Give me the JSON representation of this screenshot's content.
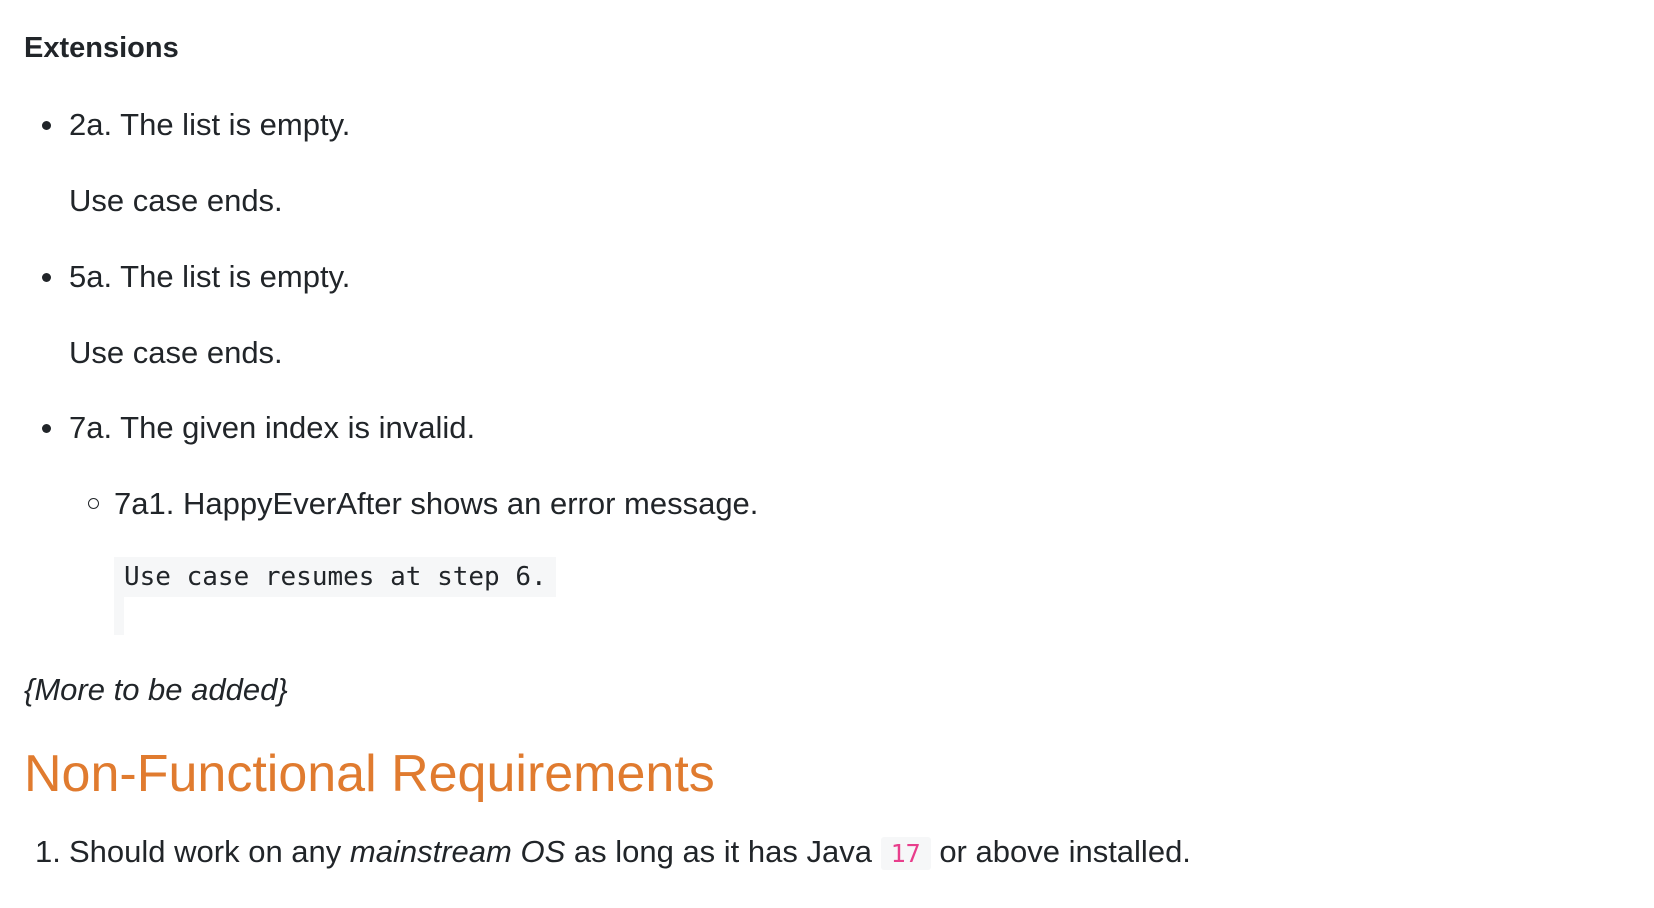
{
  "extensions": {
    "heading": "Extensions",
    "items": [
      {
        "label": "2a. The list is empty.",
        "note": "Use case ends."
      },
      {
        "label": "5a. The list is empty.",
        "note": "Use case ends."
      },
      {
        "label": "7a. The given index is invalid.",
        "sub_items": [
          {
            "label": "7a1. HappyEverAfter shows an error message.",
            "code": "Use case resumes at step 6."
          }
        ]
      }
    ]
  },
  "more_note": "{More to be added}",
  "nfr": {
    "heading": "Non-Functional Requirements",
    "items": [
      {
        "number": "1.",
        "text_before": "Should work on any ",
        "emphasis": "mainstream OS",
        "text_middle": " as long as it has Java ",
        "code": "17",
        "text_after": " or above installed."
      }
    ]
  },
  "colors": {
    "heading_accent": "#e07b2f",
    "body_text": "#212529",
    "inline_code_text": "#e83e8c",
    "code_background": "#f6f7f8"
  }
}
